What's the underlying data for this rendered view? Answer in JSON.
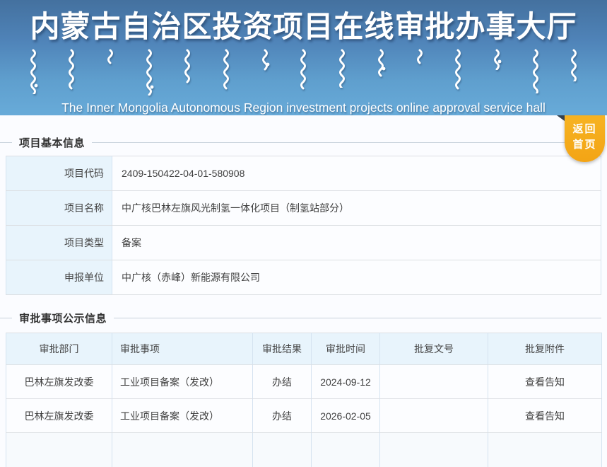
{
  "header": {
    "title_cn": "内蒙古自治区投资项目在线审批办事大厅",
    "subtitle_en": "The Inner Mongolia Autonomous Region investment projects online approval service hall",
    "back_home": {
      "line1": "返回",
      "line2": "首页"
    }
  },
  "sections": {
    "basic_info": {
      "title": "项目基本信息",
      "rows": [
        {
          "label": "项目代码",
          "value": "2409-150422-04-01-580908"
        },
        {
          "label": "项目名称",
          "value": "中广核巴林左旗风光制氢一体化项目（制氢站部分）"
        },
        {
          "label": "项目类型",
          "value": "备案"
        },
        {
          "label": "申报单位",
          "value": "中广核（赤峰）新能源有限公司"
        }
      ]
    },
    "approval_info": {
      "title": "审批事项公示信息",
      "columns": [
        "审批部门",
        "审批事项",
        "审批结果",
        "审批时间",
        "批复文号",
        "批复附件"
      ],
      "rows": [
        [
          "巴林左旗发改委",
          "工业项目备案（发改）",
          "办结",
          "2024-09-12",
          "",
          "查看告知"
        ],
        [
          "巴林左旗发改委",
          "工业项目备案（发改）",
          "办结",
          "2026-02-05",
          "",
          "查看告知"
        ]
      ]
    }
  },
  "colors": {
    "header_gradient_top": "#44719f",
    "header_gradient_bottom": "#68abd9",
    "accent_orange": "#f3a415",
    "table_header_bg": "#e8f4fc",
    "border": "#d5e3f0"
  }
}
